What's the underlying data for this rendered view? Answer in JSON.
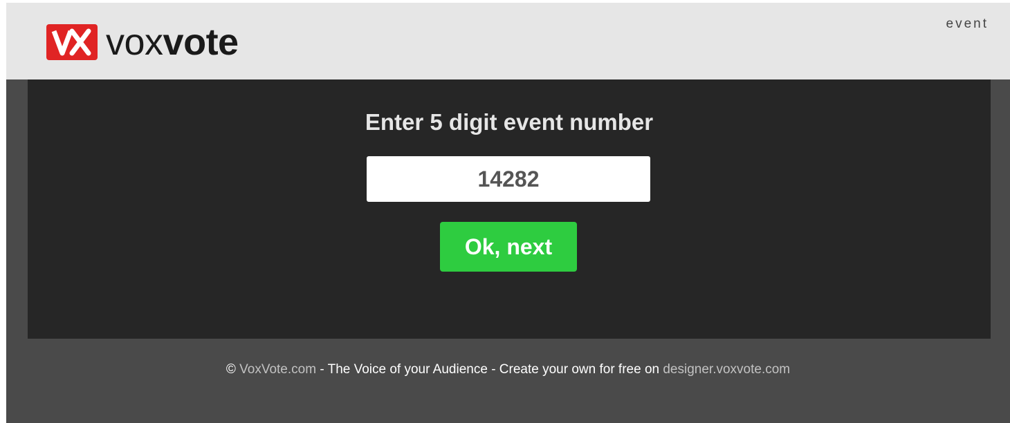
{
  "header": {
    "logo": {
      "mark_letters": "VX",
      "text_light": "vox",
      "text_bold": "vote"
    },
    "nav_link": "event"
  },
  "main": {
    "prompt": "Enter 5 digit event number",
    "event_number_value": "14282",
    "submit_label": "Ok, next"
  },
  "footer": {
    "copyright": "©",
    "site_link": "VoxVote.com",
    "tagline": " - The Voice of your Audience - Create your own for free on ",
    "designer_link": "designer.voxvote.com"
  },
  "colors": {
    "brand_red": "#e02424",
    "button_green": "#2ecc40",
    "panel_dark": "#262626",
    "frame_gray": "#4a4a4a",
    "header_bg": "#e6e6e6"
  }
}
